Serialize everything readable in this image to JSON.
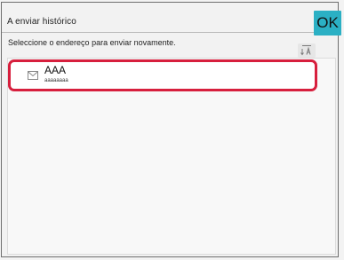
{
  "header": {
    "title": "A enviar histórico",
    "ok_label": "OK"
  },
  "instruction": "Seleccione o endereço para enviar novamente.",
  "sort_icon": "sort-az-icon",
  "items": [
    {
      "name": "AAA",
      "address": "aaaaaaaa",
      "icon": "email-icon"
    }
  ],
  "colors": {
    "accent": "#2bb0c4",
    "selection": "#d71f3d"
  }
}
